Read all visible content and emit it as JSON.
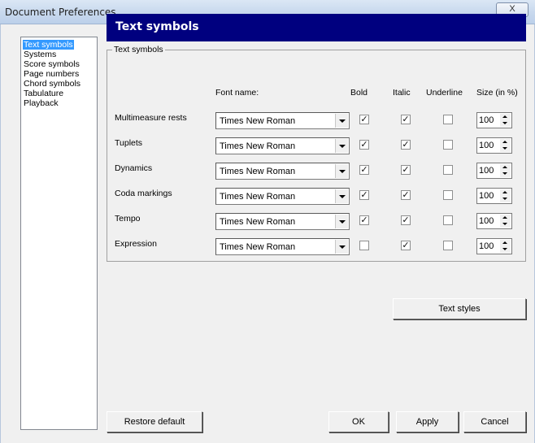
{
  "window": {
    "title": "Document Preferences",
    "close_glyph": "X"
  },
  "sidebar": {
    "items": [
      {
        "label": "Text symbols",
        "selected": true
      },
      {
        "label": "Systems"
      },
      {
        "label": "Score symbols"
      },
      {
        "label": "Page numbers"
      },
      {
        "label": "Chord symbols"
      },
      {
        "label": "Tabulature"
      },
      {
        "label": "Playback"
      }
    ]
  },
  "banner": {
    "title": "Text symbols"
  },
  "group": {
    "legend": "Text symbols",
    "headers": {
      "font": "Font name:",
      "bold": "Bold",
      "italic": "Italic",
      "underline": "Underline",
      "size": "Size (in %)"
    },
    "rows": [
      {
        "label": "Multimeasure rests",
        "font": "Times New Roman",
        "bold": true,
        "italic": true,
        "underline": false,
        "size": "100"
      },
      {
        "label": "Tuplets",
        "font": "Times New Roman",
        "bold": true,
        "italic": true,
        "underline": false,
        "size": "100"
      },
      {
        "label": "Dynamics",
        "font": "Times New Roman",
        "bold": true,
        "italic": true,
        "underline": false,
        "size": "100"
      },
      {
        "label": "Coda markings",
        "font": "Times New Roman",
        "bold": true,
        "italic": true,
        "underline": false,
        "size": "100"
      },
      {
        "label": "Tempo",
        "font": "Times New Roman",
        "bold": true,
        "italic": true,
        "underline": false,
        "size": "100"
      },
      {
        "label": "Expression",
        "font": "Times New Roman",
        "bold": false,
        "italic": true,
        "underline": false,
        "size": "100"
      }
    ]
  },
  "buttons": {
    "text_styles": "Text styles",
    "restore_default": "Restore default",
    "ok": "OK",
    "apply": "Apply",
    "cancel": "Cancel"
  },
  "colors": {
    "banner": "#00007f",
    "selection": "#3399ff",
    "dialog_bg": "#f0f0f0"
  }
}
